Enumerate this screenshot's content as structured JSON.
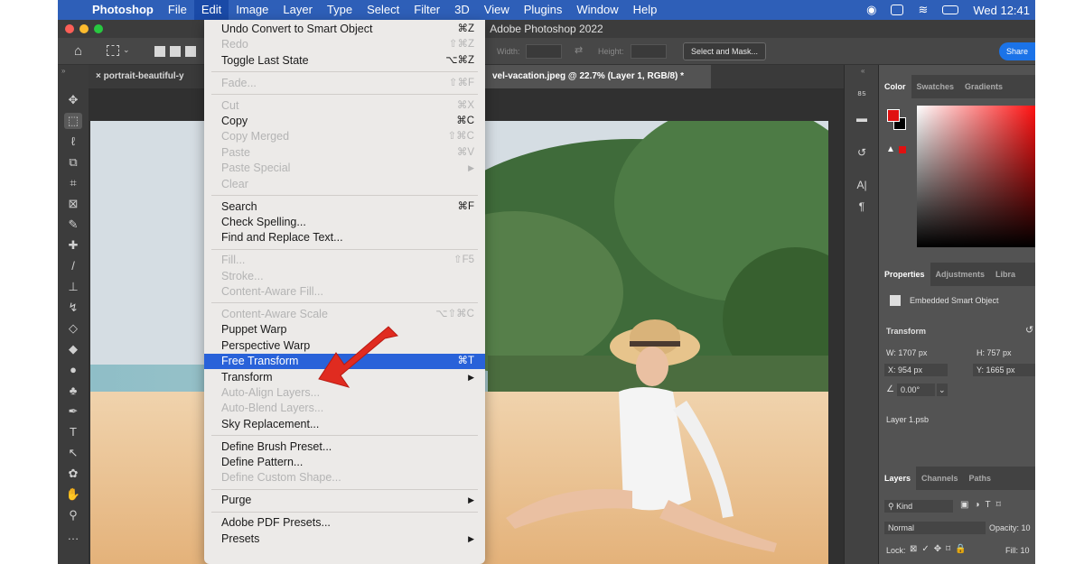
{
  "menubar": {
    "app_name": "Photoshop",
    "menus": [
      "File",
      "Edit",
      "Image",
      "Layer",
      "Type",
      "Select",
      "Filter",
      "3D",
      "View",
      "Plugins",
      "Window",
      "Help"
    ],
    "active_menu": "Edit",
    "clock": "Wed 12:41"
  },
  "window": {
    "title": "Adobe Photoshop 2022"
  },
  "options_bar": {
    "width_label": "Width:",
    "height_label": "Height:",
    "select_mask_button": "Select and Mask...",
    "share_button": "Share"
  },
  "doc_tabs": [
    {
      "label": "portrait-beautiful-y",
      "active": false
    },
    {
      "label": "vel-vacation.jpeg @ 22.7% (Layer 1, RGB/8) *",
      "active": true
    }
  ],
  "edit_menu": {
    "items": [
      {
        "label": "Undo Convert to Smart Object",
        "shortcut": "⌘Z",
        "enabled": true
      },
      {
        "label": "Redo",
        "shortcut": "⇧⌘Z",
        "enabled": false
      },
      {
        "label": "Toggle Last State",
        "shortcut": "⌥⌘Z",
        "enabled": true
      },
      {
        "separator": true
      },
      {
        "label": "Fade...",
        "shortcut": "⇧⌘F",
        "enabled": false
      },
      {
        "separator": true
      },
      {
        "label": "Cut",
        "shortcut": "⌘X",
        "enabled": false
      },
      {
        "label": "Copy",
        "shortcut": "⌘C",
        "enabled": true
      },
      {
        "label": "Copy Merged",
        "shortcut": "⇧⌘C",
        "enabled": false
      },
      {
        "label": "Paste",
        "shortcut": "⌘V",
        "enabled": false
      },
      {
        "label": "Paste Special",
        "submenu": true,
        "enabled": false
      },
      {
        "label": "Clear",
        "enabled": false
      },
      {
        "separator": true
      },
      {
        "label": "Search",
        "shortcut": "⌘F",
        "enabled": true
      },
      {
        "label": "Check Spelling...",
        "enabled": true
      },
      {
        "label": "Find and Replace Text...",
        "enabled": true
      },
      {
        "separator": true
      },
      {
        "label": "Fill...",
        "shortcut": "⇧F5",
        "enabled": false
      },
      {
        "label": "Stroke...",
        "enabled": false
      },
      {
        "label": "Content-Aware Fill...",
        "enabled": false
      },
      {
        "separator": true
      },
      {
        "label": "Content-Aware Scale",
        "shortcut": "⌥⇧⌘C",
        "enabled": false
      },
      {
        "label": "Puppet Warp",
        "enabled": true
      },
      {
        "label": "Perspective Warp",
        "enabled": true
      },
      {
        "label": "Free Transform",
        "shortcut": "⌘T",
        "enabled": true,
        "highlighted": true
      },
      {
        "label": "Transform",
        "submenu": true,
        "enabled": true
      },
      {
        "label": "Auto-Align Layers...",
        "enabled": false
      },
      {
        "label": "Auto-Blend Layers...",
        "enabled": false
      },
      {
        "label": "Sky Replacement...",
        "enabled": true
      },
      {
        "separator": true
      },
      {
        "label": "Define Brush Preset...",
        "enabled": true
      },
      {
        "label": "Define Pattern...",
        "enabled": true
      },
      {
        "label": "Define Custom Shape...",
        "enabled": false
      },
      {
        "separator": true
      },
      {
        "label": "Purge",
        "submenu": true,
        "enabled": true
      },
      {
        "separator": true
      },
      {
        "label": "Adobe PDF Presets...",
        "enabled": true
      },
      {
        "label": "Presets",
        "submenu": true,
        "enabled": true
      }
    ]
  },
  "color_panel": {
    "tabs": [
      "Color",
      "Swatches",
      "Gradients"
    ],
    "foreground_color": "#e01010",
    "background_color": "#000000"
  },
  "properties_panel": {
    "tabs": [
      "Properties",
      "Adjustments",
      "Libra"
    ],
    "object_type": "Embedded Smart Object",
    "section": "Transform",
    "w": "W: 1707 px",
    "h": "H: 757 px",
    "x": "X: 954 px",
    "y": "Y: 1665 px",
    "angle": "0.00°",
    "linked_file": "Layer 1.psb"
  },
  "layers_panel": {
    "tabs": [
      "Layers",
      "Channels",
      "Paths"
    ],
    "filter_kind": "Kind",
    "blend_mode": "Normal",
    "opacity_label": "Opacity: 10",
    "lock_label": "Lock:",
    "fill_label": "Fill: 10"
  }
}
